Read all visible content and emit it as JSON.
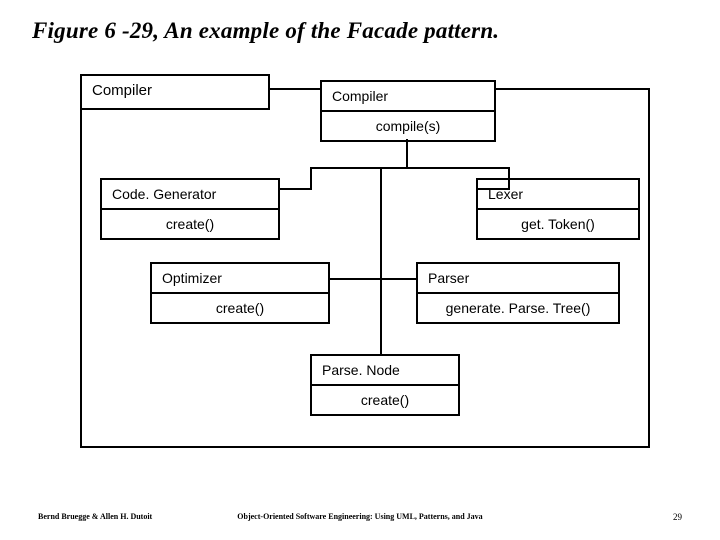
{
  "title": "Figure 6 -29, An example of the Facade pattern.",
  "package": {
    "tab_label": "Compiler"
  },
  "classes": {
    "compiler": {
      "name": "Compiler",
      "op": "compile(s)"
    },
    "codegen": {
      "name": "Code. Generator",
      "op": "create()"
    },
    "lexer": {
      "name": "Lexer",
      "op": "get. Token()"
    },
    "optimizer": {
      "name": "Optimizer",
      "op": "create()"
    },
    "parser": {
      "name": "Parser",
      "op": "generate. Parse. Tree()"
    },
    "parsenode": {
      "name": "Parse. Node",
      "op": "create()"
    }
  },
  "footer": {
    "left": "Bernd Bruegge & Allen H. Dutoit",
    "center": "Object-Oriented Software Engineering: Using UML, Patterns, and Java",
    "right": "29"
  }
}
